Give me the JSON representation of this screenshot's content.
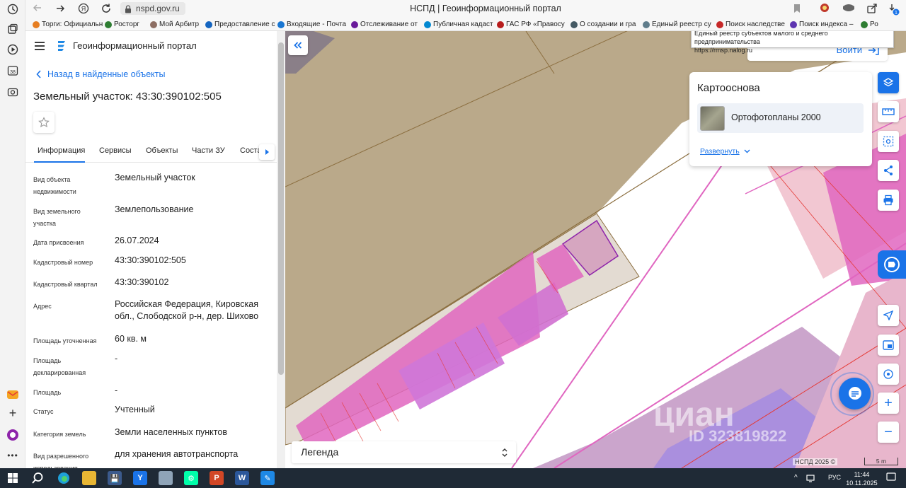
{
  "browser": {
    "url": "nspd.gov.ru",
    "page_title": "НСПД | Геоинформационный портал",
    "tooltip_title": "Единый реестр субъектов малого и среднего предпринимательства",
    "tooltip_url": "https://rmsp.nalog.ru",
    "bookmarks": [
      {
        "label": "Торги: Официальн",
        "color": "#e67e22"
      },
      {
        "label": "Росторг",
        "color": "#2e7d32"
      },
      {
        "label": "Мой Арбитр",
        "color": "#8d6e63"
      },
      {
        "label": "Предоставление с",
        "color": "#1565c0"
      },
      {
        "label": "Входящие - Почта",
        "color": "#1976d2"
      },
      {
        "label": "Отслеживание от",
        "color": "#6a1b9a"
      },
      {
        "label": "Публичная кадаст",
        "color": "#0288d1"
      },
      {
        "label": "ГАС РФ «Правосу",
        "color": "#b71c1c"
      },
      {
        "label": "О создании и гра",
        "color": "#455a64"
      },
      {
        "label": "Единый реестр су",
        "color": "#607d8b"
      },
      {
        "label": "Поиск наследстве",
        "color": "#c62828"
      },
      {
        "label": "Поиск индекса –",
        "color": "#5e35b1"
      },
      {
        "label": "Ро",
        "color": "#2e7d32"
      }
    ]
  },
  "panel": {
    "app_title": "Геоинформационный портал",
    "back_link": "Назад в найденные объекты",
    "object_title": "Земельный участок: 43:30:390102:505",
    "tabs": [
      "Информация",
      "Сервисы",
      "Объекты",
      "Части ЗУ",
      "Соста"
    ],
    "properties": [
      {
        "label": "Вид объекта недвижимости",
        "value": "Земельный участок"
      },
      {
        "label": "Вид земельного участка",
        "value": "Землепользование"
      },
      {
        "label": "Дата присвоения",
        "value": "26.07.2024"
      },
      {
        "label": "Кадастровый номер",
        "value": "43:30:390102:505"
      },
      {
        "label": "Кадастровый квартал",
        "value": "43:30:390102"
      },
      {
        "label": "Адрес",
        "value": "Российская Федерация, Кировская обл., Слободской р-н, дер. Шихово"
      },
      {
        "label": "Площадь уточненная",
        "value": "60 кв. м"
      },
      {
        "label": "Площадь декларированная",
        "value": "-"
      },
      {
        "label": "Площадь",
        "value": "-"
      },
      {
        "label": "Статус",
        "value": "Учтенный"
      },
      {
        "label": "Категория земель",
        "value": "Земли населенных пунктов"
      },
      {
        "label": "Вид разрешенного использования",
        "value": "для хранения автотранспорта"
      }
    ]
  },
  "map": {
    "login_label": "Войти",
    "basemap_title": "Картооснова",
    "basemap_option": "Ортофотопланы 2000",
    "expand_label": "Развернуть",
    "legend_label": "Легенда",
    "watermark": "циан",
    "watermark_id": "ID 323819822",
    "attribution": "НСПД 2025 ©",
    "scale_label": "5 m"
  },
  "taskbar": {
    "lang": "РУС",
    "time": "11:44",
    "date": "10.11.2025",
    "notif_count": "1"
  }
}
